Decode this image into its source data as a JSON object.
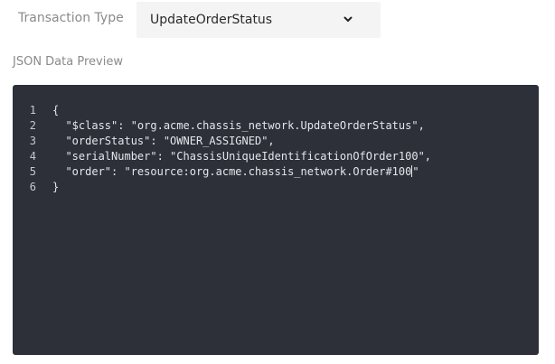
{
  "form": {
    "transaction_type_label": "Transaction Type",
    "transaction_type_value": "UpdateOrderStatus",
    "json_preview_label": "JSON Data Preview"
  },
  "editor": {
    "lines": [
      {
        "number": "1",
        "text": "{"
      },
      {
        "number": "2",
        "text": "  \"$class\": \"org.acme.chassis_network.UpdateOrderStatus\","
      },
      {
        "number": "3",
        "text": "  \"orderStatus\": \"OWNER_ASSIGNED\","
      },
      {
        "number": "4",
        "text": "  \"serialNumber\": \"ChassisUniqueIdentificationOfOrder100\","
      },
      {
        "number": "5",
        "text_before_cursor": "  \"order\": \"resource:org.acme.chassis_network.Order#100",
        "text_after_cursor": "\""
      },
      {
        "number": "6",
        "text": "}"
      }
    ]
  },
  "colors": {
    "editor_background": "#2d3039",
    "select_background": "#f4f4f4",
    "label_text": "#8a8a8a"
  },
  "icons": {
    "select_chevron": "chevron-down-icon"
  }
}
